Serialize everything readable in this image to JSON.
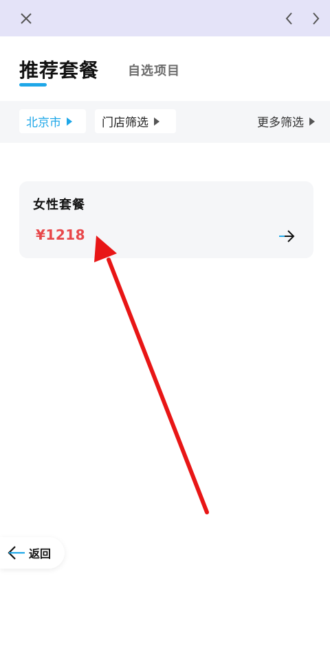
{
  "topbar": {
    "close_icon": "close-icon",
    "prev_icon": "chevron-left-icon",
    "next_icon": "chevron-right-icon"
  },
  "tabs": {
    "active_label": "推荐套餐",
    "inactive_label": "自选项目",
    "accent_color": "#1ea7e8"
  },
  "filters": {
    "city_label": "北京市",
    "store_label": "门店筛选",
    "more_label": "更多筛选"
  },
  "packages": [
    {
      "title": "女性套餐",
      "price": "¥1218",
      "price_color": "#e8474a"
    }
  ],
  "back": {
    "label": "返回"
  }
}
